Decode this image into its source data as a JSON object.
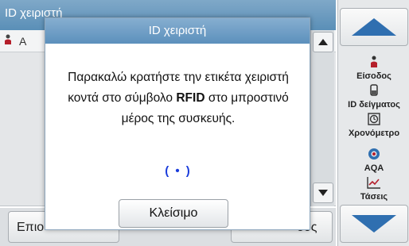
{
  "background": {
    "title": "ID χειριστή",
    "row_label": "A",
    "bottom_left_label": "Επιο",
    "bottom_right_label": "δος"
  },
  "sidebar": {
    "items": [
      {
        "label": "Είσοδος",
        "icon": "user-icon"
      },
      {
        "label": "ID δείγματος",
        "icon": "sample-vial-icon"
      },
      {
        "label": "Χρονόμετρο",
        "icon": "timer-icon"
      },
      {
        "label": "AQA",
        "icon": "aqa-icon"
      },
      {
        "label": "Τάσεις",
        "icon": "trend-chart-icon"
      }
    ]
  },
  "dialog": {
    "title": "ID χειριστή",
    "message_part1": "Παρακαλώ κρατήστε την ετικέτα χειριστή κοντά στο σύμβολο",
    "message_bold": "RFID",
    "message_part2": "στο μπροστινό μέρος της συσκευής.",
    "indicator": "( • )",
    "close_label": "Κλείσιμο"
  },
  "colors": {
    "title_bar": "#5c90bc",
    "accent_blue": "#2f6fb0",
    "indicator": "#1a3cdb"
  }
}
